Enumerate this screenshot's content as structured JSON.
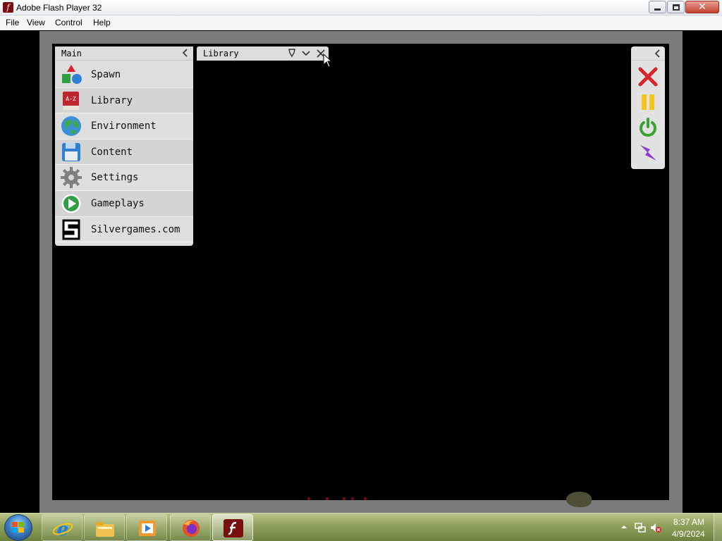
{
  "window": {
    "title": "Adobe Flash Player 32",
    "app_icon": "flash-player-icon",
    "controls": [
      "minimize",
      "maximize",
      "close"
    ]
  },
  "menubar": {
    "items": [
      {
        "label": "File"
      },
      {
        "label": "View"
      },
      {
        "label": "Control"
      },
      {
        "label": "Help"
      }
    ]
  },
  "main_panel": {
    "title": "Main",
    "collapse_icon": "chevron-left-icon",
    "items": [
      {
        "label": "Spawn",
        "icon": "shapes-icon"
      },
      {
        "label": "Library",
        "icon": "book-az-icon"
      },
      {
        "label": "Environment",
        "icon": "globe-icon"
      },
      {
        "label": "Content",
        "icon": "floppy-disk-icon"
      },
      {
        "label": "Settings",
        "icon": "gear-icon"
      },
      {
        "label": "Gameplays",
        "icon": "play-icon"
      },
      {
        "label": "Silvergames.com",
        "icon": "silvergames-logo-icon"
      }
    ]
  },
  "library_tab": {
    "title": "Library",
    "buttons": [
      "pin-icon",
      "chevron-down-icon",
      "close-icon"
    ]
  },
  "tool_panel": {
    "collapse_icon": "chevron-left-icon",
    "buttons": [
      {
        "icon": "x-icon",
        "color": "#d8232a"
      },
      {
        "icon": "pause-icon",
        "color": "#f5c518"
      },
      {
        "icon": "power-icon",
        "color": "#3aa335"
      },
      {
        "icon": "lightning-icon",
        "color": "#8a3fd1"
      }
    ]
  },
  "taskbar": {
    "apps": [
      "internet-explorer-icon",
      "file-explorer-icon",
      "media-player-icon",
      "firefox-icon",
      "flash-player-icon"
    ],
    "active_app": "flash-player-icon",
    "clock": {
      "time": "8:37 AM",
      "date": "4/9/2024"
    }
  },
  "colors": {
    "stage_background": "#000000",
    "stage_frame": "#7b7b7b",
    "panel_background": "#dedede",
    "taskbar": "#8da05a"
  }
}
